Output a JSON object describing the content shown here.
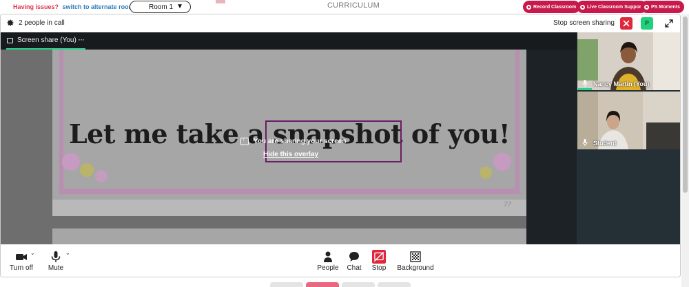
{
  "topbar": {
    "issues_text": "Having issues?",
    "switch_link": "switch to alternate room",
    "room_value": "Room 1",
    "room_caret": "▼",
    "curriculum": "CURRICULUM",
    "pills": [
      "Record Classroom",
      "Live Classroom Support",
      "PS Moments"
    ]
  },
  "header": {
    "people_count": "2 people in call",
    "stop_sharing_label": "Stop screen sharing",
    "p_badge": "P",
    "icons": [
      "gear-icon",
      "close-icon",
      "expand-icon"
    ]
  },
  "share": {
    "tab_label": "Screen share (You)",
    "tab_more": "···",
    "headline": "Let me take a snapshot of you!",
    "page_number": "77",
    "overlay_message": "You are sharing your screen",
    "hide_overlay": "Hide this overlay"
  },
  "participants": [
    {
      "name": "Nancy Martin (You)",
      "speaking": true
    },
    {
      "name": "Student",
      "speaking": false
    }
  ],
  "toolbar": {
    "left": [
      {
        "label": "Turn off",
        "icon": "camera-icon"
      },
      {
        "label": "Mute",
        "icon": "microphone-icon"
      }
    ],
    "center": [
      {
        "label": "People",
        "icon": "person-icon"
      },
      {
        "label": "Chat",
        "icon": "chat-icon"
      },
      {
        "label": "Stop",
        "icon": "stop-share-icon"
      },
      {
        "label": "Background",
        "icon": "background-icon"
      }
    ]
  },
  "colors": {
    "accent_red": "#c8194b",
    "stop_red": "#e0283c",
    "active_green": "#28d38a",
    "link_blue": "#2b7bb9"
  }
}
